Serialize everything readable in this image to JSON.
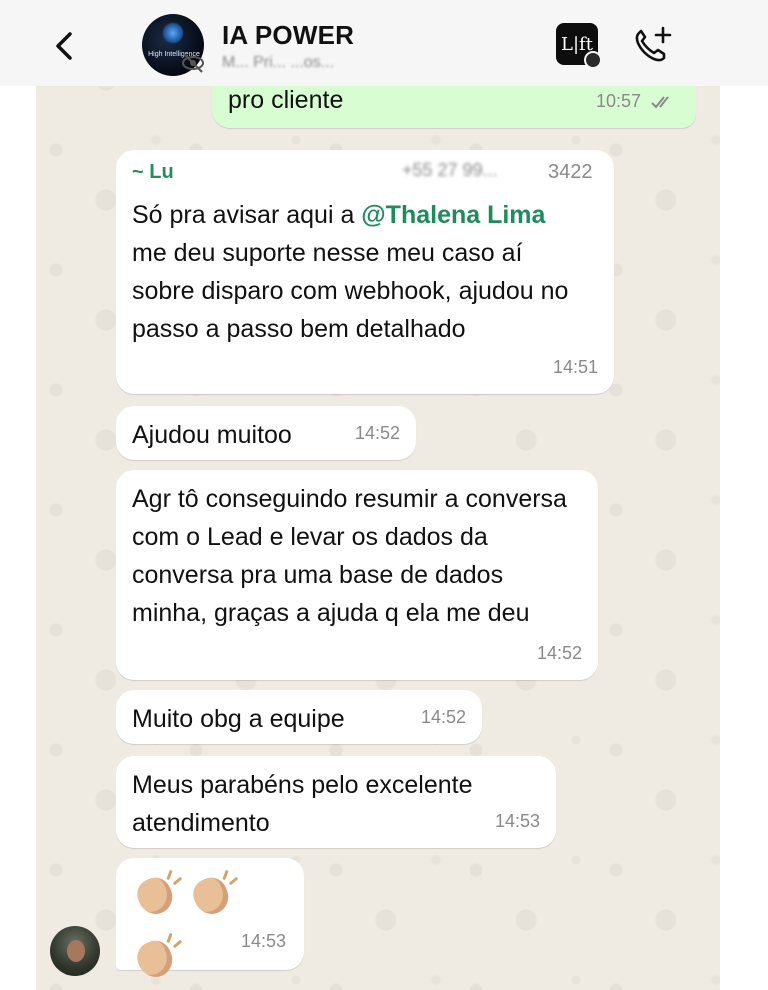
{
  "header": {
    "back_icon": "chevron-left-icon",
    "group_name": "IA POWER",
    "avatar_text": "High Intelligence",
    "subtitle": "M... Pri...   ...os...",
    "app_icon_label": "L|ft",
    "call_icon": "phone-add-icon"
  },
  "messages": [
    {
      "id": "m0",
      "direction": "out",
      "text": "pro cliente",
      "time": "10:57",
      "status": "read"
    },
    {
      "id": "m1",
      "direction": "in",
      "sender": "~ Lu",
      "sender_phone_suffix": "3422",
      "text_before": "Só pra avisar aqui a ",
      "mention": "@Thalena Lima",
      "text_after": " me deu suporte nesse meu caso aí sobre disparo com webhook, ajudou no passo a passo bem detalhado",
      "time": "14:51"
    },
    {
      "id": "m2",
      "direction": "in",
      "text": "Ajudou muitoo",
      "time": "14:52"
    },
    {
      "id": "m3",
      "direction": "in",
      "text": "Agr tô conseguindo resumir a conversa com o Lead e levar os dados da conversa pra uma base de dados minha, graças a ajuda q ela me deu",
      "time": "14:52"
    },
    {
      "id": "m4",
      "direction": "in",
      "text": "Muito obg a equipe",
      "time": "14:52"
    },
    {
      "id": "m5",
      "direction": "in",
      "text": "Meus parabéns pelo excelente atendimento",
      "time": "14:53"
    },
    {
      "id": "m6",
      "direction": "in",
      "text": "👏🏼👏🏼👏🏼",
      "emoji_names": [
        "clapping-hands-icon",
        "clapping-hands-icon",
        "clapping-hands-icon"
      ],
      "time": "14:53"
    }
  ],
  "colors": {
    "chat_bg": "#efeae2",
    "out_bubble": "#d9fdd3",
    "in_bubble": "#ffffff",
    "mention": "#1f8a5b",
    "sender": "#2a8c5d"
  }
}
